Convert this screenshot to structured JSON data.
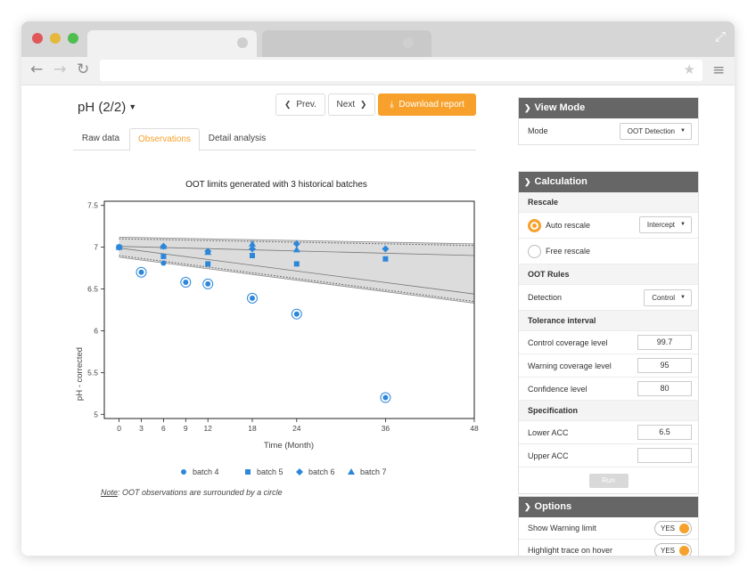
{
  "page": {
    "title": "pH (2/2)",
    "prev_label": "Prev.",
    "next_label": "Next",
    "download_label": "Download report",
    "tabs": [
      "Raw data",
      "Observations",
      "Detail analysis"
    ],
    "active_tab": "Observations",
    "note_prefix": "Note",
    "note_text": ": OOT observations are surrounded by a circle"
  },
  "colors": {
    "accent": "#f7a12c",
    "series": "#2d87d9",
    "panel_header": "#666666"
  },
  "chart_data": {
    "type": "scatter",
    "title": "OOT limits generated with 3 historical batches",
    "xlabel": "Time (Month)",
    "ylabel": "pH - corrected",
    "xlim": [
      -2,
      48
    ],
    "ylim": [
      4.95,
      7.55
    ],
    "x_ticks": [
      0,
      3,
      6,
      9,
      12,
      18,
      24,
      36,
      48
    ],
    "y_ticks": [
      5,
      5.5,
      6,
      6.5,
      7,
      7.5
    ],
    "legend_position": "bottom",
    "series": [
      {
        "name": "batch 4",
        "marker": "circle",
        "points": [
          [
            0,
            7.0
          ],
          [
            3,
            6.7
          ],
          [
            6,
            6.81
          ],
          [
            9,
            6.58
          ],
          [
            12,
            6.56
          ],
          [
            18,
            6.39
          ],
          [
            24,
            6.2
          ],
          [
            36,
            5.2
          ]
        ],
        "oot_circled": [
          [
            3,
            6.7
          ],
          [
            9,
            6.58
          ],
          [
            12,
            6.56
          ],
          [
            18,
            6.39
          ],
          [
            24,
            6.2
          ],
          [
            36,
            5.2
          ]
        ]
      },
      {
        "name": "batch 5",
        "marker": "square",
        "points": [
          [
            0,
            7.0
          ],
          [
            6,
            6.89
          ],
          [
            12,
            6.8
          ],
          [
            18,
            6.9
          ],
          [
            24,
            6.8
          ],
          [
            36,
            6.86
          ]
        ]
      },
      {
        "name": "batch 6",
        "marker": "diamond",
        "points": [
          [
            0,
            7.0
          ],
          [
            6,
            7.01
          ],
          [
            12,
            6.95
          ],
          [
            18,
            6.98
          ],
          [
            24,
            7.04
          ],
          [
            36,
            6.98
          ]
        ]
      },
      {
        "name": "batch 7",
        "marker": "triangle",
        "points": [
          [
            0,
            7.0
          ],
          [
            6,
            7.01
          ],
          [
            12,
            6.94
          ],
          [
            18,
            7.04
          ],
          [
            24,
            6.97
          ]
        ]
      }
    ],
    "oot_band": {
      "upper": [
        [
          0,
          7.12
        ],
        [
          48,
          7.04
        ]
      ],
      "lower": [
        [
          0,
          6.88
        ],
        [
          48,
          6.33
        ]
      ],
      "warning_upper": [
        [
          0,
          7.1
        ],
        [
          48,
          7.02
        ]
      ],
      "warning_lower": [
        [
          0,
          6.9
        ],
        [
          48,
          6.35
        ]
      ],
      "trend_upper": [
        [
          0,
          7.01
        ],
        [
          48,
          6.9
        ]
      ],
      "trend_lower": [
        [
          0,
          6.99
        ],
        [
          48,
          6.44
        ]
      ]
    }
  },
  "sidebar": {
    "view_mode": {
      "header": "View Mode",
      "mode_label": "Mode",
      "mode_value": "OOT Detection"
    },
    "calculation": {
      "header": "Calculation",
      "rescale_label": "Rescale",
      "auto_rescale": "Auto rescale",
      "auto_rescale_value": "Intercept",
      "free_rescale": "Free rescale",
      "oot_rules": "OOT Rules",
      "detection_label": "Detection",
      "detection_value": "Control",
      "tolerance_label": "Tolerance interval",
      "control_coverage_label": "Control coverage level",
      "control_coverage_value": "99.7",
      "warning_coverage_label": "Warning coverage level",
      "warning_coverage_value": "95",
      "confidence_label": "Confidence level",
      "confidence_value": "80",
      "specification_label": "Specification",
      "lower_acc_label": "Lower ACC",
      "lower_acc_value": "6.5",
      "upper_acc_label": "Upper ACC",
      "upper_acc_value": "",
      "run_label": "Run"
    },
    "options": {
      "header": "Options",
      "show_warning_label": "Show Warning limit",
      "show_warning_value": "YES",
      "highlight_label": "Highlight trace on hover",
      "highlight_value": "YES"
    }
  }
}
